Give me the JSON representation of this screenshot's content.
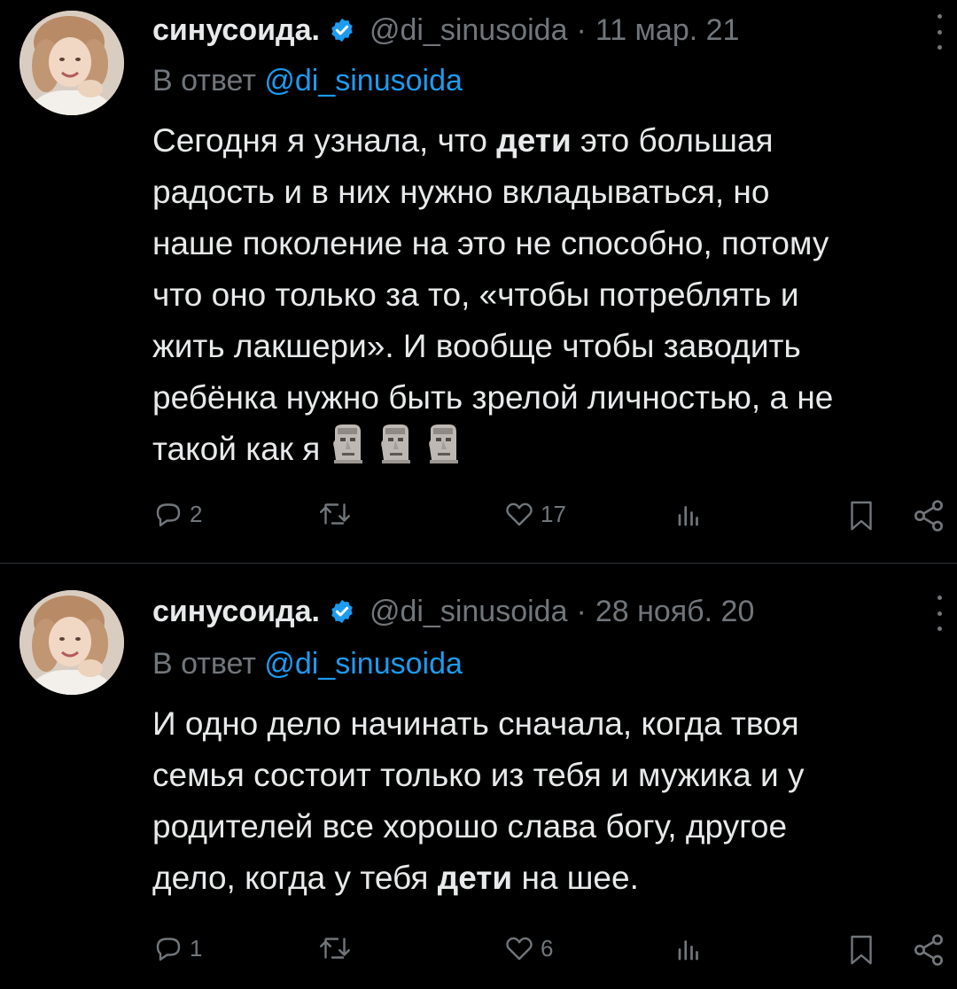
{
  "colors": {
    "background": "#000000",
    "text": "#e7e9ea",
    "muted": "#71767b",
    "accent": "#1d9bf0",
    "verified": "#1d9bf0"
  },
  "tweets": [
    {
      "author_name": "синусоида.",
      "verified_icon": "verified-badge-icon",
      "handle": "@di_sinusoida",
      "separator": "·",
      "date": "11 мар. 21",
      "reply_prefix": "В ответ",
      "reply_handle": "@di_sinusoida",
      "body_lines": [
        {
          "pre": "Сегодня я узнала, что ",
          "bold": "дети",
          "post": " это большая"
        },
        {
          "text": "радость и в них нужно вкладываться, но"
        },
        {
          "text": "наше поколение на это не способно, потому"
        },
        {
          "text": "что оно только за то, «чтобы потреблять и"
        },
        {
          "text": "жить лакшери». И вообще чтобы заводить"
        },
        {
          "text": "ребёнка нужно быть зрелой личностью, а не"
        },
        {
          "text": "такой как я"
        }
      ],
      "emoji": [
        "moai",
        "moai",
        "moai"
      ],
      "actions": {
        "replies": "2",
        "retweets": "",
        "likes": "17",
        "views": ""
      }
    },
    {
      "author_name": "синусоида.",
      "verified_icon": "verified-badge-icon",
      "handle": "@di_sinusoida",
      "separator": "·",
      "date": "28 нояб. 20",
      "reply_prefix": "В ответ",
      "reply_handle": "@di_sinusoida",
      "body_lines": [
        {
          "text": "И одно дело начинать сначала, когда твоя"
        },
        {
          "text": "семья состоит только из тебя и мужика и у"
        },
        {
          "text": "родителей все хорошо слава богу, другое"
        },
        {
          "pre": "дело, когда у тебя ",
          "bold": "дети",
          "post": " на шее."
        }
      ],
      "actions": {
        "replies": "1",
        "retweets": "",
        "likes": "6",
        "views": ""
      }
    }
  ]
}
